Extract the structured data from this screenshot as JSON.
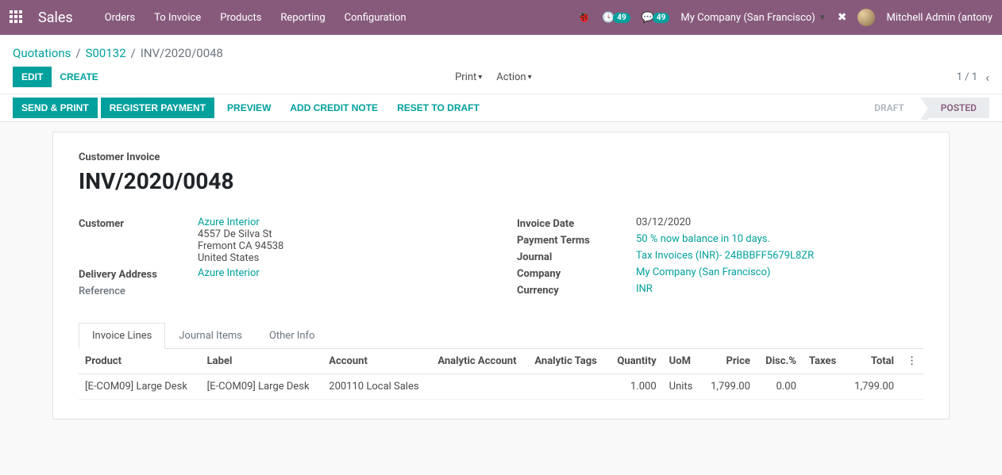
{
  "topnav": {
    "brand": "Sales",
    "links": [
      "Orders",
      "To Invoice",
      "Products",
      "Reporting",
      "Configuration"
    ],
    "badge1": "49",
    "badge2": "49",
    "company": "My Company (San Francisco)",
    "user": "Mitchell Admin (antony"
  },
  "breadcrumb": {
    "root": "Quotations",
    "order": "S00132",
    "current": "INV/2020/0048"
  },
  "controls": {
    "edit": "EDIT",
    "create": "CREATE",
    "print": "Print",
    "action": "Action",
    "pager": "1 / 1"
  },
  "statusbar": {
    "send_print": "SEND & PRINT",
    "register_payment": "REGISTER PAYMENT",
    "preview": "PREVIEW",
    "add_credit_note": "ADD CREDIT NOTE",
    "reset_to_draft": "RESET TO DRAFT",
    "draft": "DRAFT",
    "posted": "POSTED"
  },
  "sheet": {
    "subtitle": "Customer Invoice",
    "title": "INV/2020/0048",
    "left": {
      "customer_label": "Customer",
      "customer_name": "Azure Interior",
      "addr1": "4557 De Silva St",
      "addr2": "Fremont CA 94538",
      "addr3": "United States",
      "delivery_label": "Delivery Address",
      "delivery_value": "Azure Interior",
      "reference_label": "Reference"
    },
    "right": {
      "invoice_date_label": "Invoice Date",
      "invoice_date": "03/12/2020",
      "payment_terms_label": "Payment Terms",
      "payment_terms": "50 % now balance in 10 days.",
      "journal_label": "Journal",
      "journal": "Tax Invoices (INR)- 24BBBFF5679L8ZR",
      "company_label": "Company",
      "company": "My Company (San Francisco)",
      "currency_label": "Currency",
      "currency": "INR"
    }
  },
  "tabs": {
    "t1": "Invoice Lines",
    "t2": "Journal Items",
    "t3": "Other Info"
  },
  "table": {
    "headers": {
      "product": "Product",
      "label": "Label",
      "account": "Account",
      "analytic_account": "Analytic Account",
      "analytic_tags": "Analytic Tags",
      "quantity": "Quantity",
      "uom": "UoM",
      "price": "Price",
      "disc": "Disc.%",
      "taxes": "Taxes",
      "total": "Total"
    },
    "rows": [
      {
        "product": "[E-COM09] Large Desk",
        "label": "[E-COM09] Large Desk",
        "account": "200110 Local Sales",
        "analytic_account": "",
        "analytic_tags": "",
        "quantity": "1.000",
        "uom": "Units",
        "price": "1,799.00",
        "disc": "0.00",
        "taxes": "",
        "total": "1,799.00"
      }
    ]
  }
}
